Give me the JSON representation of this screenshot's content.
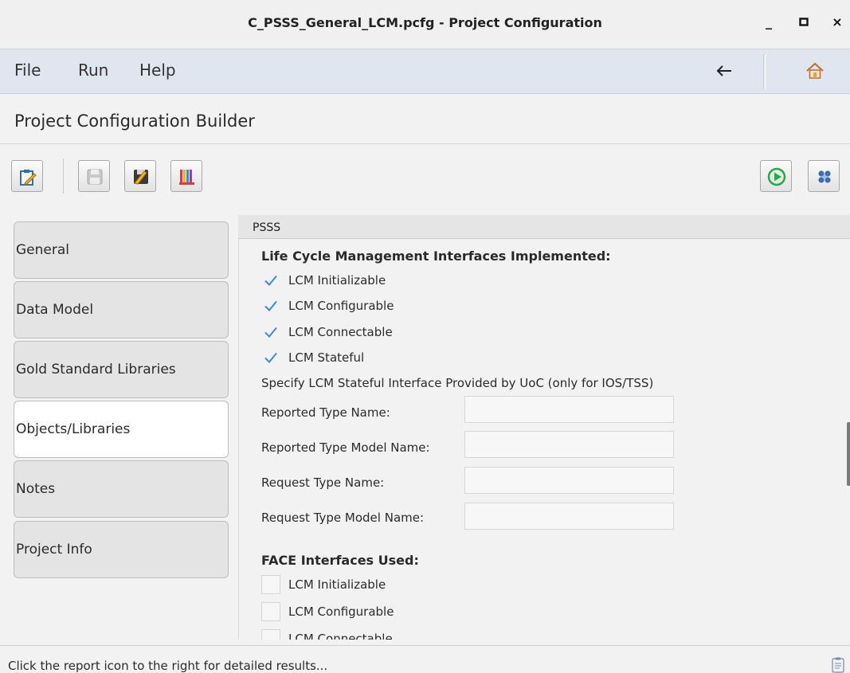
{
  "window": {
    "title": "C_PSSS_General_LCM.pcfg - Project Configuration",
    "minimize": "_",
    "maximize": "□",
    "close": "×"
  },
  "menu": {
    "file": "File",
    "run": "Run",
    "help": "Help",
    "back_icon": "back-arrow-icon",
    "home_icon": "home-icon"
  },
  "header": {
    "title": "Project Configuration Builder"
  },
  "toolbar": {
    "buttons": [
      {
        "name": "edit-button",
        "icon": "edit-clipboard-icon",
        "enabled": true
      },
      {
        "name": "save-button",
        "icon": "floppy-disk-icon",
        "enabled": false
      },
      {
        "name": "save-as-button",
        "icon": "save-as-icon",
        "enabled": true
      },
      {
        "name": "library-button",
        "icon": "books-icon",
        "enabled": true
      },
      {
        "name": "run-button",
        "icon": "play-circle-icon",
        "enabled": true
      },
      {
        "name": "settings-button",
        "icon": "gear-cluster-icon",
        "enabled": true
      }
    ]
  },
  "sidebar": {
    "items": [
      {
        "label": "General",
        "active": false
      },
      {
        "label": "Data Model",
        "active": false
      },
      {
        "label": "Gold Standard Libraries",
        "active": false
      },
      {
        "label": "Objects/Libraries",
        "active": true
      },
      {
        "label": "Notes",
        "active": false
      },
      {
        "label": "Project Info",
        "active": false
      }
    ]
  },
  "panel": {
    "header": "PSSS",
    "lcm_title": "Life Cycle Management Interfaces Implemented:",
    "lcm_items": [
      {
        "label": "LCM Initializable",
        "checked": true
      },
      {
        "label": "LCM Configurable",
        "checked": true
      },
      {
        "label": "LCM Connectable",
        "checked": true
      },
      {
        "label": "LCM Stateful",
        "checked": true
      }
    ],
    "stateful_note": "Specify LCM Stateful Interface Provided by UoC (only for IOS/TSS)",
    "fields": [
      {
        "label": "Reported Type Name:",
        "value": ""
      },
      {
        "label": "Reported Type Model Name:",
        "value": ""
      },
      {
        "label": "Request Type Name:",
        "value": ""
      },
      {
        "label": "Request Type Model Name:",
        "value": ""
      }
    ],
    "face_title": "FACE Interfaces Used:",
    "face_items": [
      {
        "label": "LCM Initializable",
        "checked": false
      },
      {
        "label": "LCM Configurable",
        "checked": false
      },
      {
        "label": "LCM Connectable",
        "checked": false
      }
    ]
  },
  "status": {
    "text": "Click the report icon to the right for detailed results...",
    "report_icon": "report-clipboard-icon"
  },
  "colors": {
    "menubar_bg": "#dfe6ef",
    "check_blue": "#3f8ad8",
    "run_green": "#2aa84a",
    "active_tab": "#ffffff",
    "inactive_tab": "#e4e4e4"
  }
}
